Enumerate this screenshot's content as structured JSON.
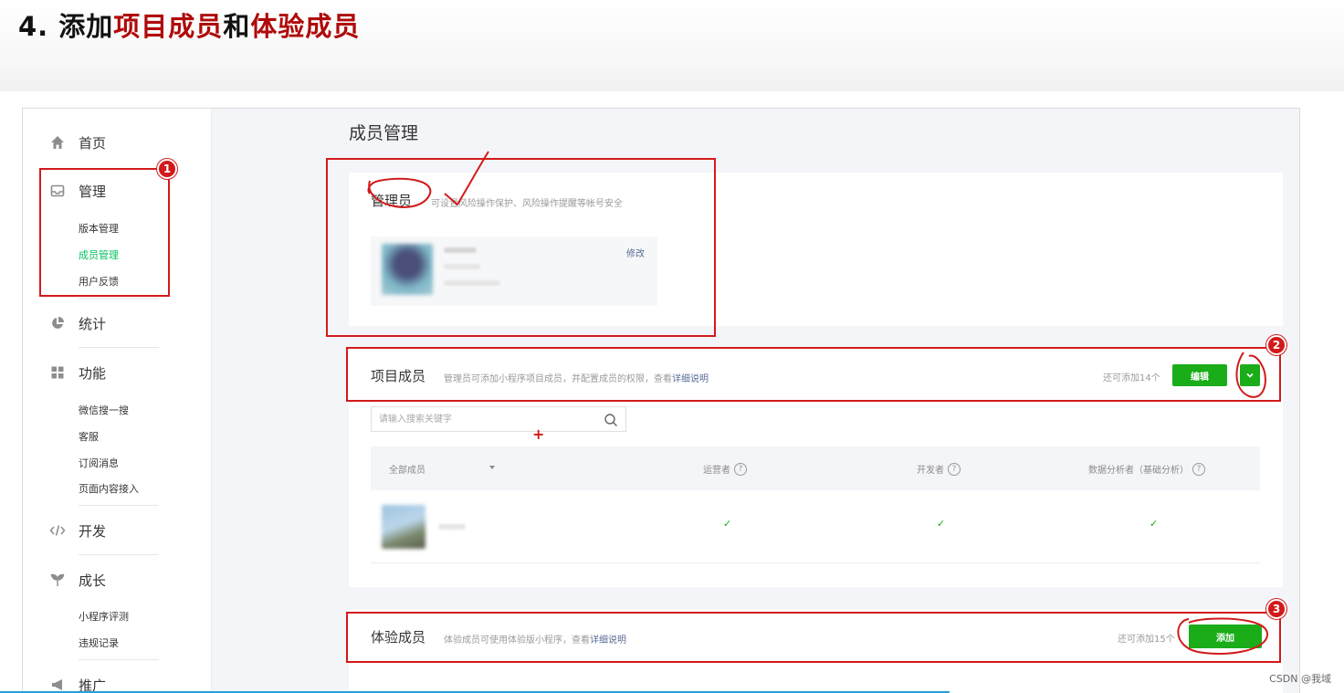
{
  "slide": {
    "title_prefix": "4. 添加",
    "title_hl1": "项目成员",
    "title_mid": "和",
    "title_hl2": "体验成员"
  },
  "sidebar": {
    "home": "首页",
    "manage": "管理",
    "manage_items": [
      "版本管理",
      "成员管理",
      "用户反馈"
    ],
    "stats": "统计",
    "features": "功能",
    "feature_items": [
      "微信搜一搜",
      "客服",
      "订阅消息",
      "页面内容接入"
    ],
    "dev": "开发",
    "growth": "成长",
    "growth_items": [
      "小程序评测",
      "违规记录"
    ],
    "promote": "推广"
  },
  "main": {
    "page_title": "成员管理",
    "admin": {
      "title": "管理员",
      "desc": "可设置风险操作保护、风险操作提醒等帐号安全",
      "edit": "修改"
    },
    "project": {
      "title": "项目成员",
      "desc": "管理员可添加小程序项目成员，并配置成员的权限，查看",
      "desc_link": "详细说明",
      "quota": "还可添加14个",
      "edit_btn": "编辑",
      "search_placeholder": "请输入搜索关键字",
      "columns": [
        "全部成员",
        "运营者",
        "开发者",
        "数据分析者（基础分析）"
      ],
      "row_checks": [
        "✓",
        "✓",
        "✓"
      ]
    },
    "tester": {
      "title": "体验成员",
      "desc": "体验成员可使用体验版小程序，查看",
      "desc_link": "详细说明",
      "quota": "还可添加15个",
      "add_btn": "添加"
    }
  },
  "annotations": {
    "badge1": "1",
    "badge2": "2",
    "badge3": "3",
    "plus": "+"
  },
  "watermark": "CSDN @我域",
  "colors": {
    "accent_green": "#1aad19",
    "annotation_red": "#d21a1a",
    "link_blue": "#576b95",
    "title_red": "#b00a0a"
  }
}
